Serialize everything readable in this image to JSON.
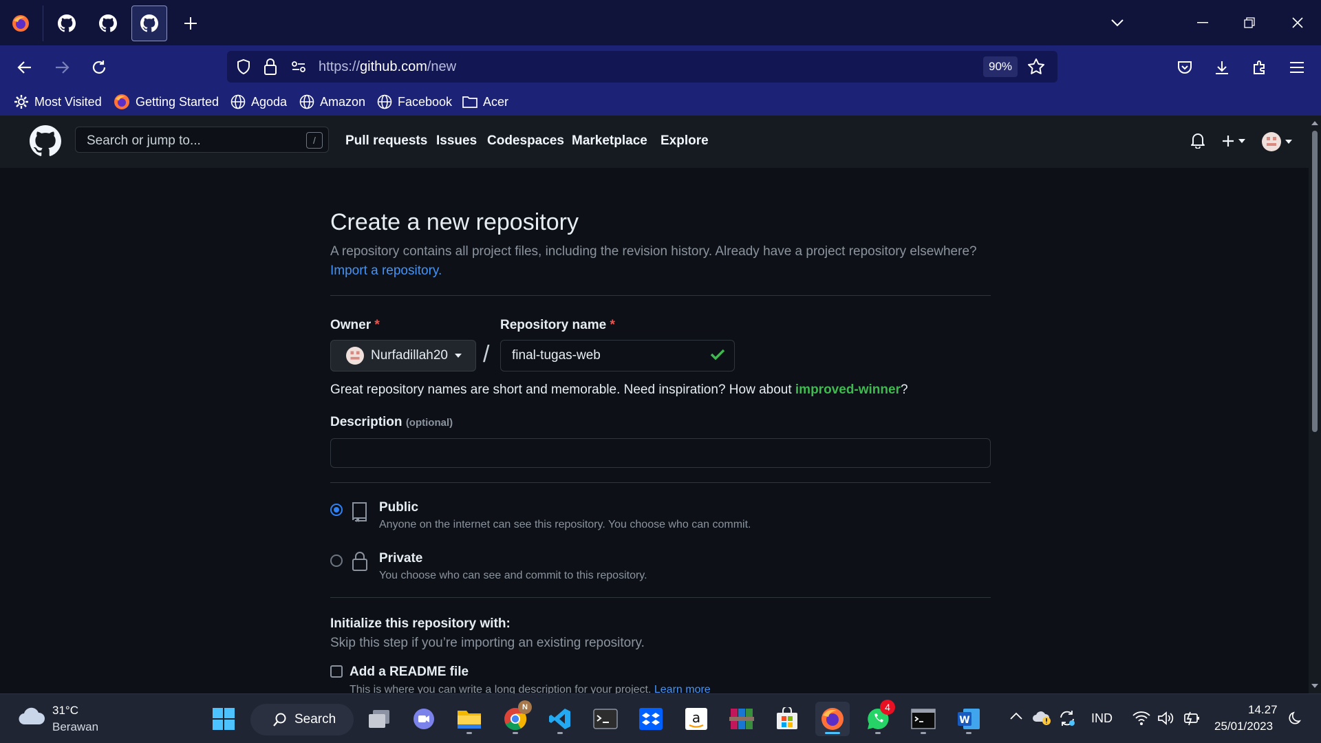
{
  "browser": {
    "url_scheme": "https://",
    "url_host": "github.com",
    "url_path": "/new",
    "zoom": "90%",
    "bookmarks": [
      "Most Visited",
      "Getting Started",
      "Agoda",
      "Amazon",
      "Facebook",
      "Acer"
    ]
  },
  "github": {
    "search_placeholder": "Search or jump to...",
    "search_key": "/",
    "nav": [
      "Pull requests",
      "Issues",
      "Codespaces",
      "Marketplace",
      "Explore"
    ]
  },
  "form": {
    "title": "Create a new repository",
    "description": "A repository contains all project files, including the revision history. Already have a project repository elsewhere?",
    "import_link": "Import a repository.",
    "owner_label": "Owner",
    "required_mark": "*",
    "owner_value": "Nurfadillah20",
    "separator": "/",
    "repo_label": "Repository name",
    "repo_value": "final-tugas-web",
    "hint_prefix": "Great repository names are short and memorable. Need inspiration? How about ",
    "hint_suggestion": "improved-winner",
    "hint_suffix": "?",
    "description_label": "Description",
    "description_optional": "(optional)",
    "description_value": "",
    "visibility": [
      {
        "title": "Public",
        "subtitle": "Anyone on the internet can see this repository. You choose who can commit.",
        "checked": true
      },
      {
        "title": "Private",
        "subtitle": "You choose who can see and commit to this repository.",
        "checked": false
      }
    ],
    "init_title": "Initialize this repository with:",
    "init_subtitle": "Skip this step if you’re importing an existing repository.",
    "readme_label": "Add a README file",
    "readme_sub": "This is where you can write a long description for your project. ",
    "readme_learn": "Learn more"
  },
  "taskbar": {
    "weather_temp": "31°C",
    "weather_desc": "Berawan",
    "search_label": "Search",
    "whatsapp_badge": "4",
    "chrome_badge": "N",
    "language": "IND",
    "time": "14.27",
    "date": "25/01/2023"
  },
  "colors": {
    "tab_strip": "#10143a",
    "browser_toolbar": "#1c2377",
    "github_bg": "#0d1117",
    "link": "#4493f8",
    "success": "#3fb950",
    "required": "#f85149"
  }
}
